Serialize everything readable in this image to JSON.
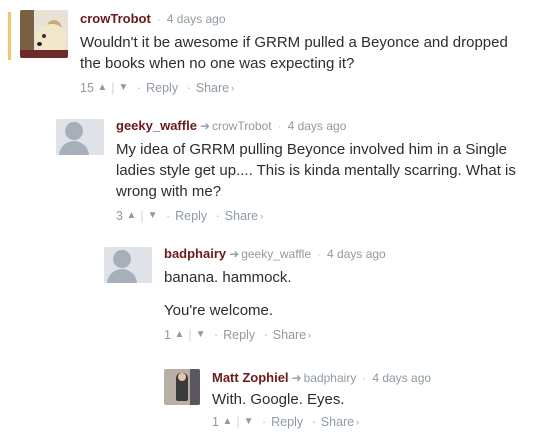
{
  "comments": [
    {
      "author": "crowTrobot",
      "reply_to": "",
      "time": "4 days ago",
      "paragraphs": [
        "Wouldn't it be awesome if GRRM pulled a Beyonce and dropped the books when no one was expecting it?"
      ],
      "votes": "15",
      "reply_label": "Reply",
      "share_label": "Share"
    },
    {
      "author": "geeky_waffle",
      "reply_to": "crowTrobot",
      "time": "4 days ago",
      "paragraphs": [
        "My idea of GRRM pulling Beyonce involved him in a Single ladies style get up.... This is kinda mentally scarring. What is wrong with me?"
      ],
      "votes": "3",
      "reply_label": "Reply",
      "share_label": "Share"
    },
    {
      "author": "badphairy",
      "reply_to": "geeky_waffle",
      "time": "4 days ago",
      "paragraphs": [
        "banana. hammock.",
        "You're welcome."
      ],
      "votes": "1",
      "reply_label": "Reply",
      "share_label": "Share"
    },
    {
      "author": "Matt Zophiel",
      "reply_to": "badphairy",
      "time": "4 days ago",
      "paragraphs": [
        "With. Google. Eyes."
      ],
      "votes": "1",
      "reply_label": "Reply",
      "share_label": "Share"
    }
  ],
  "icons": {
    "upvote": "chevron-up-icon",
    "downvote": "chevron-down-icon",
    "reply_arrow": "reply-arrow-icon",
    "share": "chevron-right-icon"
  },
  "colors": {
    "author": "#6b1a1a",
    "highlight": "#f1c86e",
    "meta": "#8f9aa2"
  }
}
